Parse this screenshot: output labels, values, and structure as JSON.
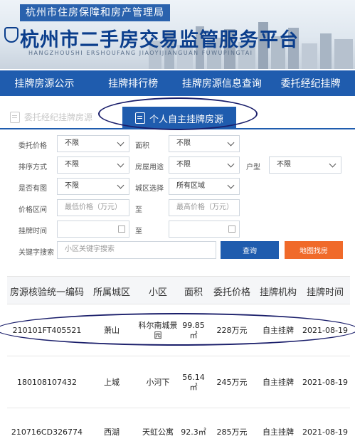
{
  "header": {
    "agency": "杭州市住房保障和房产管理局",
    "platform_title": "杭州市二手房交易监管服务平台",
    "pinyin": "HANGZHOUSHI  ERSHOUFANG  JIAOYIJIANGUAN  FUWUPINGTAI"
  },
  "nav": {
    "items": [
      "挂牌房源公示",
      "挂牌排行榜",
      "挂牌房源信息查询",
      "委托经纪挂牌"
    ]
  },
  "mode_tabs": {
    "broker_label": "委托经纪挂牌房源",
    "self_label": "个人自主挂牌房源"
  },
  "filters": {
    "commission_price_label": "委托价格",
    "commission_price_value": "不限",
    "area_label": "面积",
    "area_value": "不限",
    "sort_label": "排序方式",
    "sort_value": "不限",
    "usage_label": "房屋用途",
    "usage_value": "不限",
    "layout_label": "户型",
    "layout_value": "不限",
    "image_label": "是否有图",
    "image_value": "不限",
    "district_label": "城区选择",
    "district_value": "所有区域",
    "price_range_label": "价格区间",
    "price_min_placeholder": "最低价格（万元）",
    "to_label_1": "至",
    "price_max_placeholder": "最高价格（万元）",
    "listing_time_label": "挂牌时间",
    "to_label_2": "至",
    "keyword_label": "关键字搜索",
    "keyword_placeholder": "小区关键字搜索",
    "query_button": "查询",
    "map_button": "地图找房"
  },
  "table": {
    "headers": [
      "房源核验统一编码",
      "所属城区",
      "小区",
      "面积",
      "委托价格",
      "挂牌机构",
      "挂牌时间"
    ],
    "rows": [
      {
        "code": "210101FT405521",
        "district": "萧山",
        "community": "科尔南城景园",
        "area": "99.85㎡",
        "price": "228万元",
        "agency": "自主挂牌",
        "date": "2021-08-19"
      },
      {
        "code": "180108107432",
        "district": "上城",
        "community": "小河下",
        "area": "56.14㎡",
        "price": "245万元",
        "agency": "自主挂牌",
        "date": "2021-08-19"
      },
      {
        "code": "210716CD326774",
        "district": "西湖",
        "community": "天虹公寓",
        "area": "92.3㎡",
        "price": "285万元",
        "agency": "自主挂牌",
        "date": "2021-08-19"
      }
    ]
  },
  "colors": {
    "nav_blue": "#1f5cae",
    "map_orange": "#f06a2a",
    "annotation_ink": "#1b1f6b"
  }
}
